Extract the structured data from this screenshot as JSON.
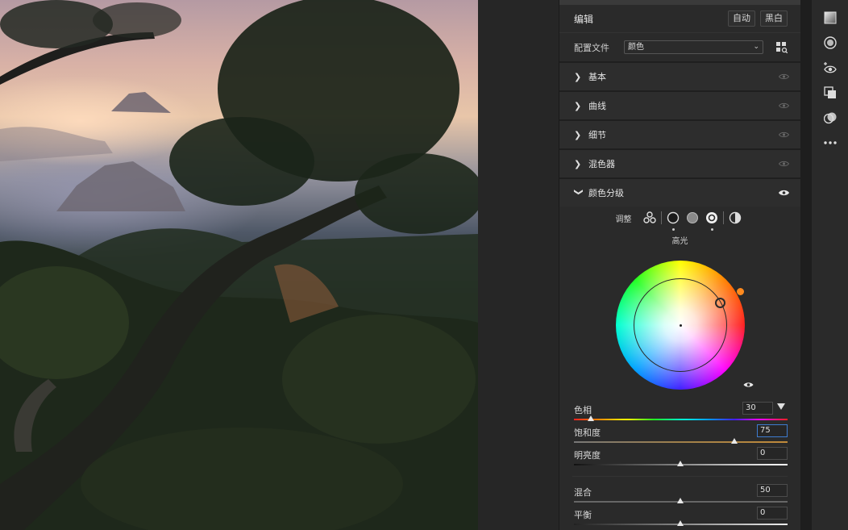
{
  "panel": {
    "title": "编辑",
    "auto_button": "自动",
    "bw_button": "黑白",
    "profile_label": "配置文件",
    "profile_value": "颜色"
  },
  "sections": [
    {
      "label": "基本",
      "open": false
    },
    {
      "label": "曲线",
      "open": false
    },
    {
      "label": "细节",
      "open": false
    },
    {
      "label": "混色器",
      "open": false
    },
    {
      "label": "颜色分级",
      "open": true
    }
  ],
  "color_grading": {
    "adjust_label": "调整",
    "modes": [
      "three-way-icon",
      "shadows-icon",
      "midtones-icon",
      "highlights-icon",
      "global-icon"
    ],
    "selected_mode": "highlights",
    "wheel_title": "高光",
    "sliders": {
      "hue": {
        "label": "色相",
        "value": "30"
      },
      "saturation": {
        "label": "饱和度",
        "value": "75"
      },
      "luminance": {
        "label": "明亮度",
        "value": "0"
      },
      "blending": {
        "label": "混合",
        "value": "50"
      },
      "balance": {
        "label": "平衡",
        "value": "0"
      }
    }
  },
  "colors": {
    "accent_handle": "#ff8a1e",
    "focus_border": "#3e7cd0"
  }
}
